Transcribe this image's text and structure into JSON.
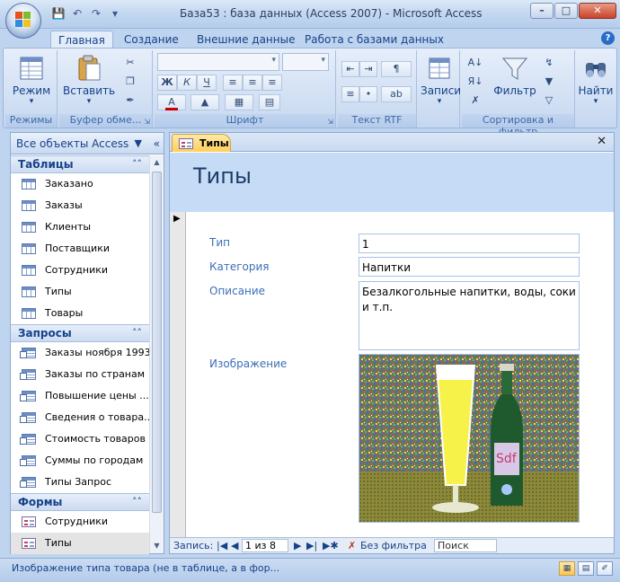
{
  "window": {
    "title": "База53 : база данных (Access 2007) - Microsoft Access"
  },
  "ribbon": {
    "tabs": [
      "Главная",
      "Создание",
      "Внешние данные",
      "Работа с базами данных"
    ],
    "groups": {
      "views": {
        "label": "Режимы",
        "button": "Режим"
      },
      "clipboard": {
        "label": "Буфер обме...",
        "button": "Вставить"
      },
      "font": {
        "label": "Шрифт"
      },
      "rtf": {
        "label": "Текст RTF"
      },
      "records": {
        "button": "Записи"
      },
      "sort": {
        "label": "Сортировка и фильтр",
        "button": "Фильтр"
      },
      "find": {
        "button": "Найти"
      }
    }
  },
  "nav": {
    "header": "Все объекты Access",
    "sections": [
      {
        "title": "Таблицы",
        "items": [
          "Заказано",
          "Заказы",
          "Клиенты",
          "Поставщики",
          "Сотрудники",
          "Типы",
          "Товары"
        ]
      },
      {
        "title": "Запросы",
        "items": [
          "Заказы ноября 1993",
          "Заказы по странам",
          "Повышение цены ...",
          "Сведения о товара...",
          "Стоимость товаров",
          "Суммы по городам",
          "Типы Запрос"
        ]
      },
      {
        "title": "Формы",
        "items": [
          "Сотрудники",
          "Типы"
        ]
      }
    ]
  },
  "document": {
    "tab_label": "Типы",
    "form_title": "Типы",
    "fields": [
      {
        "label": "Тип",
        "value": "1"
      },
      {
        "label": "Категория",
        "value": "Напитки"
      },
      {
        "label": "Описание",
        "value": "Безалкогольные напитки, воды, соки и т.п."
      },
      {
        "label": "Изображение",
        "value": ""
      }
    ]
  },
  "record_nav": {
    "label": "Запись:",
    "position": "1 из 8",
    "filter": "Без фильтра",
    "search_placeholder": "Поиск"
  },
  "status": {
    "text": "Изображение типа товара (не в таблице, а в фор..."
  }
}
